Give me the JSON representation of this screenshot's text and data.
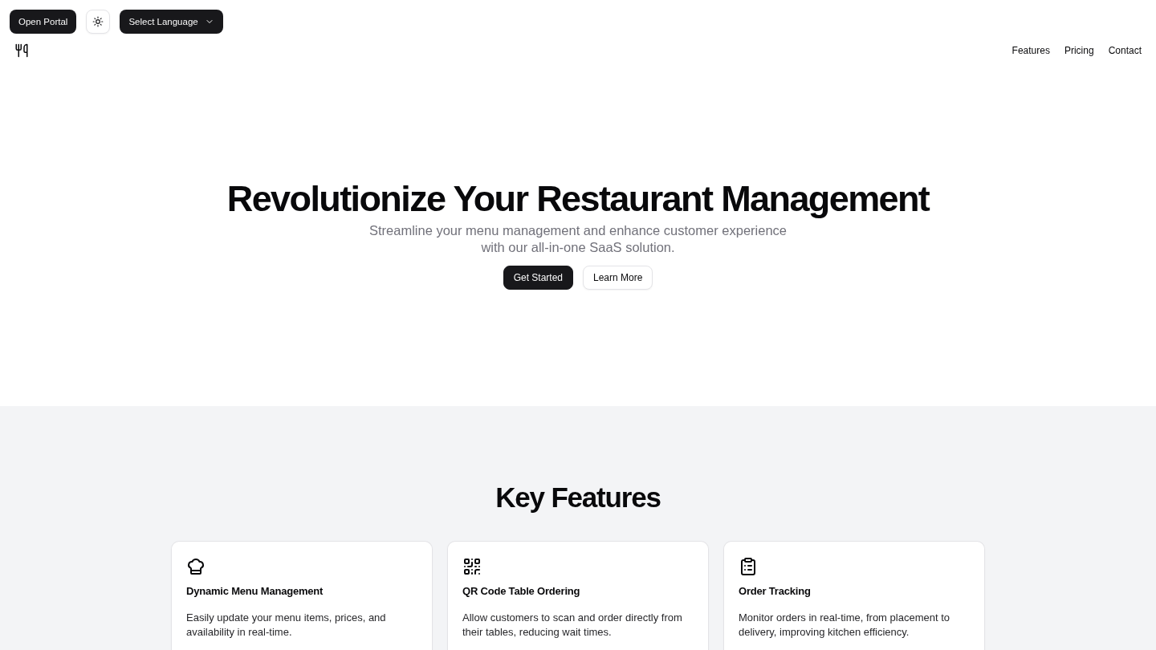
{
  "toolbar": {
    "portal_button": "Open Portal",
    "language_select": "Select Language"
  },
  "header": {
    "nav": [
      "Features",
      "Pricing",
      "Contact"
    ]
  },
  "hero": {
    "title": "Revolutionize Your Restaurant Management",
    "subtitle": "Streamline your menu management and enhance customer experience with our all-in-one SaaS solution.",
    "buttons": [
      {
        "label": "Get Started",
        "kind": "primary"
      },
      {
        "label": "Learn More",
        "kind": "outline"
      }
    ]
  },
  "features": {
    "title": "Key Features",
    "cards": [
      {
        "title": "Dynamic Menu Management",
        "description": "Easily update your menu items, prices, and availability in real-time."
      },
      {
        "title": "QR Code Table Ordering",
        "description": "Allow customers to scan and order directly from their tables, reducing wait times."
      },
      {
        "title": "Order Tracking",
        "description": "Monitor orders in real-time, from placement to delivery, improving kitchen efficiency."
      }
    ]
  }
}
